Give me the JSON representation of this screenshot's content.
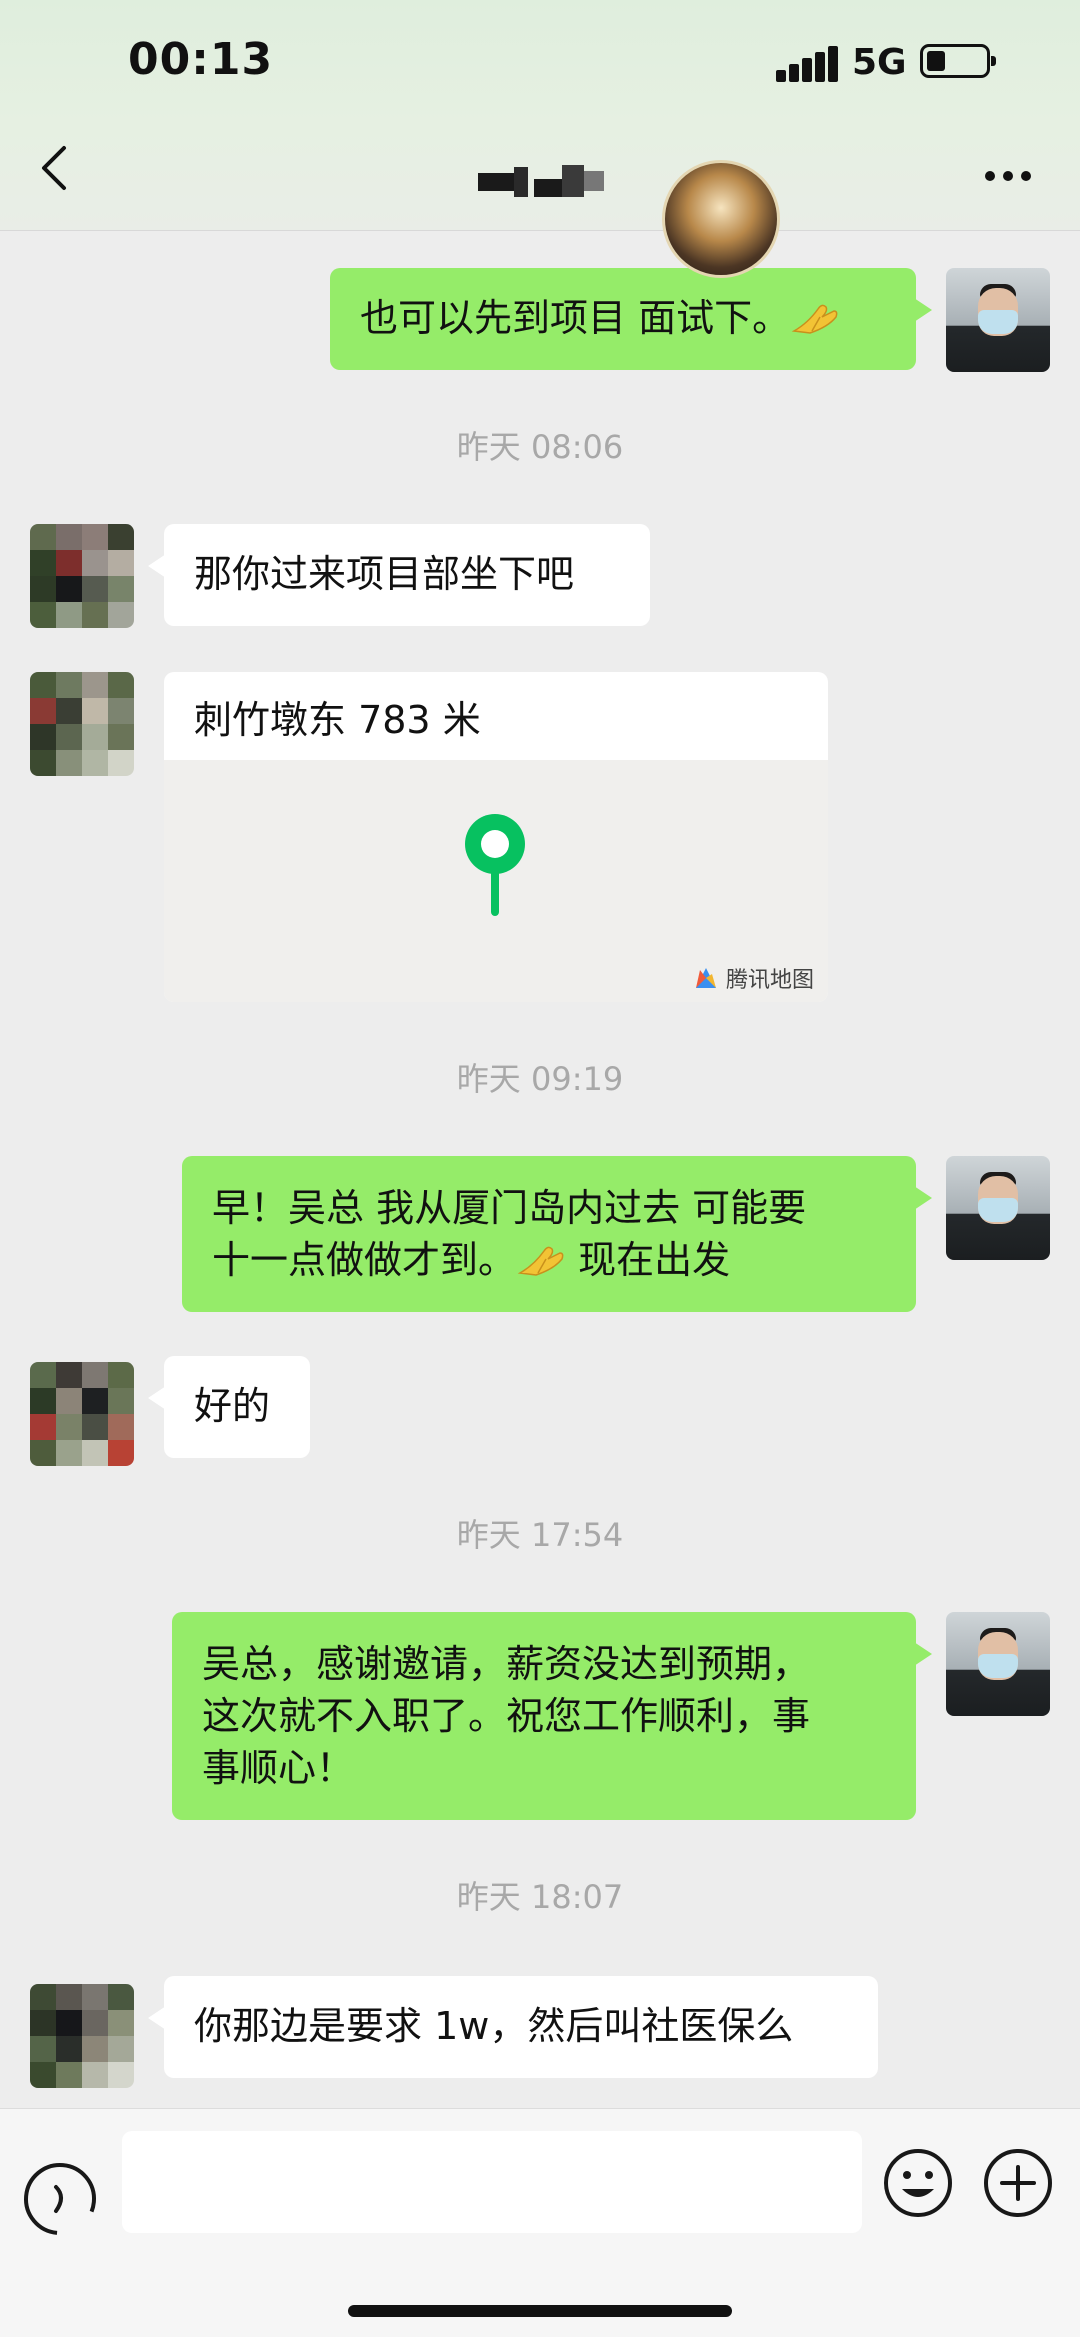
{
  "status_bar": {
    "time": "00:13",
    "network": "5G"
  },
  "header": {
    "back_icon": "chevron-left-icon",
    "more_icon": "more-dots-icon"
  },
  "messages": [
    {
      "from": "me",
      "text": "也可以先到项目 面试下。"
    },
    {
      "timestamp": "昨天 08:06"
    },
    {
      "from": "other",
      "text": "那你过来项目部坐下吧"
    },
    {
      "from": "other",
      "type": "location",
      "text": "刺竹墩东 783 米",
      "map_brand": "腾讯地图"
    },
    {
      "timestamp": "昨天 09:19"
    },
    {
      "from": "me",
      "line1": "早！吴总 我从厦门岛内过去  可能要",
      "line2a": "十一点做做才到。",
      "line2b": " 现在出发"
    },
    {
      "from": "other",
      "text": "好的"
    },
    {
      "timestamp": "昨天 17:54"
    },
    {
      "from": "me",
      "line1": "吴总，感谢邀请，薪资没达到预期，",
      "line2": "这次就不入职了。祝您工作顺利，事",
      "line3": "事顺心！"
    },
    {
      "timestamp": "昨天 18:07"
    },
    {
      "from": "other",
      "text": "你那边是要求 1w，然后叫社医保么"
    }
  ],
  "input_bar": {
    "voice_icon": "voice-icon",
    "emoji_icon": "emoji-icon",
    "plus_icon": "plus-icon",
    "value": ""
  },
  "colors": {
    "my_bubble": "#95ec69",
    "other_bubble": "#ffffff",
    "background": "#ededed",
    "pin": "#07c160"
  }
}
